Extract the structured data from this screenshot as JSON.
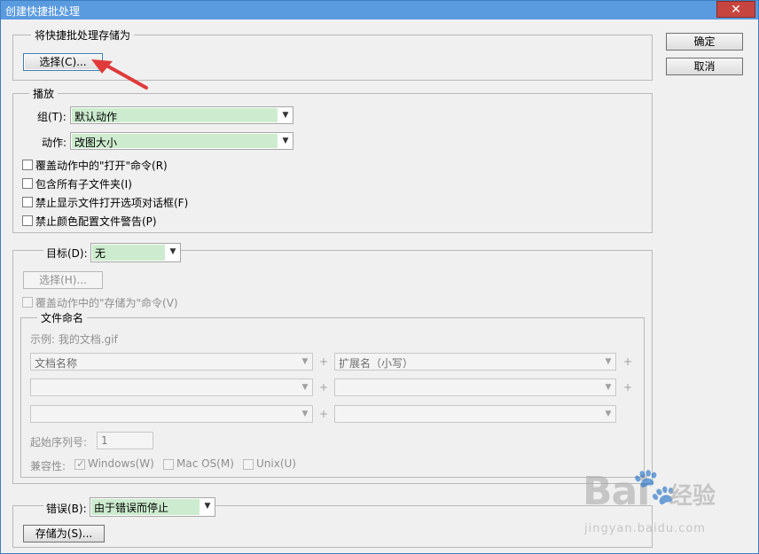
{
  "window": {
    "title": "创建快捷批处理",
    "close_glyph": "✕"
  },
  "buttons": {
    "ok": "确定",
    "cancel": "取消"
  },
  "save_as_group": {
    "legend": "将快捷批处理存储为",
    "choose_button": "选择(C)..."
  },
  "play_group": {
    "legend": "播放",
    "group_label": "组(T):",
    "group_value": "默认动作",
    "action_label": "动作:",
    "action_value": "改图大小",
    "checkboxes": [
      {
        "label": "覆盖动作中的\"打开\"命令(R)",
        "checked": false
      },
      {
        "label": "包含所有子文件夹(I)",
        "checked": false
      },
      {
        "label": "禁止显示文件打开选项对话框(F)",
        "checked": false
      },
      {
        "label": "禁止颜色配置文件警告(P)",
        "checked": false
      }
    ]
  },
  "destination_group": {
    "label": "目标(D):",
    "value": "无",
    "choose_button": "选择(H)...",
    "override_save_checkbox": "覆盖动作中的\"存储为\"命令(V)",
    "naming": {
      "legend": "文件命名",
      "example": "示例: 我的文档.gif",
      "rows": [
        {
          "left": "文档名称",
          "right": "扩展名（小写）"
        },
        {
          "left": "",
          "right": ""
        },
        {
          "left": "",
          "right": ""
        }
      ],
      "plus": "+",
      "start_serial_label": "起始序列号:",
      "start_serial_value": "1",
      "compat_label": "兼容性:",
      "compat": [
        {
          "label": "Windows(W)",
          "checked": true
        },
        {
          "label": "Mac OS(M)",
          "checked": false
        },
        {
          "label": "Unix(U)",
          "checked": false
        }
      ]
    }
  },
  "error_group": {
    "label": "错误(B):",
    "value": "由于错误而停止",
    "save_as_button": "存储为(S)..."
  },
  "watermark": {
    "brand": "Bai",
    "paw": "🐾",
    "brand2": "经验",
    "url": "jingyan.baidu.com"
  },
  "colors": {
    "titlebar": "#5a9be0",
    "close": "#c7453f",
    "selected_fill": "#cdeccf",
    "arrow": "#e03a3a"
  }
}
